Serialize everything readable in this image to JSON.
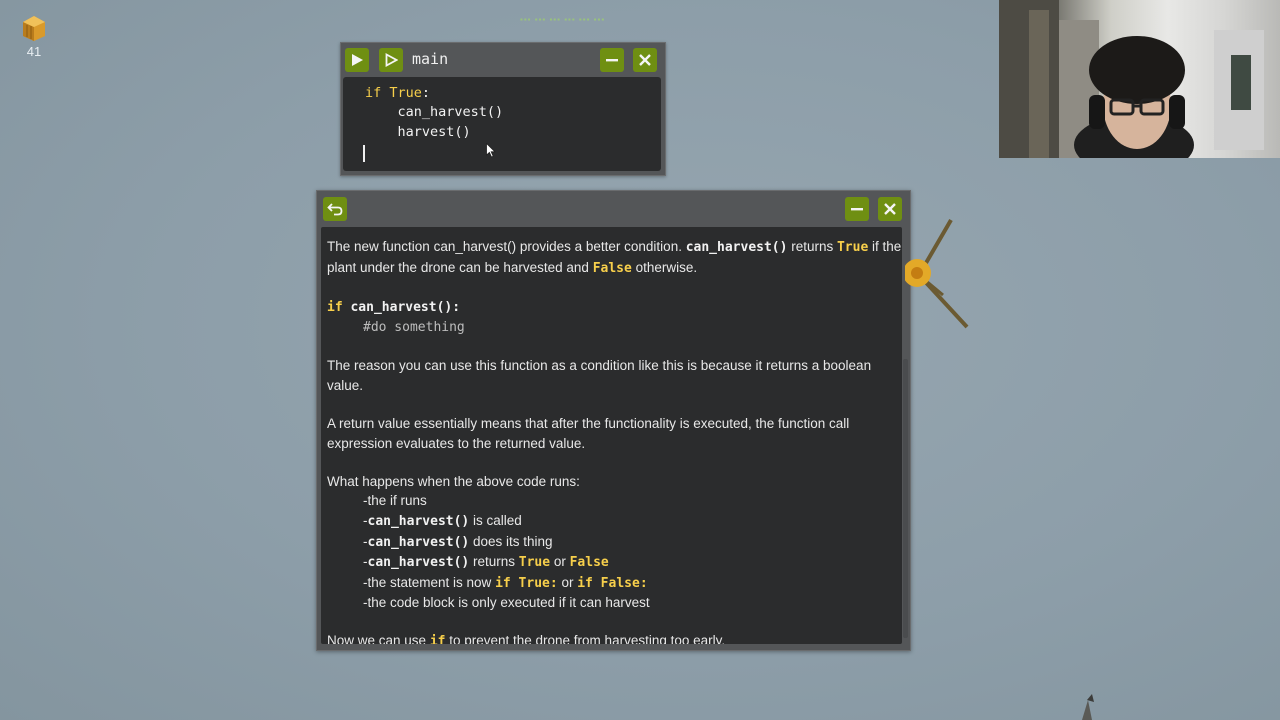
{
  "inventory": {
    "icon": "hay-icon",
    "count": "41"
  },
  "code_window": {
    "title": "main",
    "buttons": {
      "run": "play-icon",
      "step": "step-icon",
      "minimize": "minimize-icon",
      "close": "close-icon"
    },
    "code": {
      "line1_kw1": "if",
      "line1_kw2": "True",
      "line1_rest": ":",
      "line2": "    can_harvest()",
      "line3": "    harvest()"
    }
  },
  "info_window": {
    "p1": {
      "t1": "The new function can_harvest() provides a better condition. ",
      "c1": "can_harvest()",
      "t2": " returns ",
      "y1": "True",
      "t3": " if the plant under the drone can be harvested and ",
      "y2": "False",
      "t4": " otherwise."
    },
    "code_example": {
      "kw": "if",
      "call": " can_harvest():",
      "comment": "#do something"
    },
    "p2": "The reason you can use this function as a condition like this is because it returns a boolean value.",
    "p3": "A return value essentially means that after the functionality is executed, the function call expression evaluates to the returned value.",
    "p4_intro": "What happens when the above code runs:",
    "steps": {
      "s1": "-the if runs",
      "s2_pre": "-",
      "s2_code": "can_harvest()",
      "s2_post": " is called",
      "s3_pre": "-",
      "s3_code": "can_harvest()",
      "s3_post": " does its thing",
      "s4_pre": "-",
      "s4_code": "can_harvest()",
      "s4_mid": " returns ",
      "s4_y1": "True",
      "s4_or": " or ",
      "s4_y2": "False",
      "s5_pre": "-the statement is now ",
      "s5_y1": "if True:",
      "s5_or": " or ",
      "s5_y2": "if False:",
      "s6": "-the code block is only executed if it can harvest"
    },
    "p5": {
      "t1": "Now we can use ",
      "y1": "if",
      "t2": " to prevent the drone from harvesting too early."
    }
  },
  "colors": {
    "accent": "#6f8f12",
    "keyword": "#f7cf4b",
    "panel": "#2b2c2d",
    "frame": "#545658",
    "background": "#8d9ea9"
  }
}
